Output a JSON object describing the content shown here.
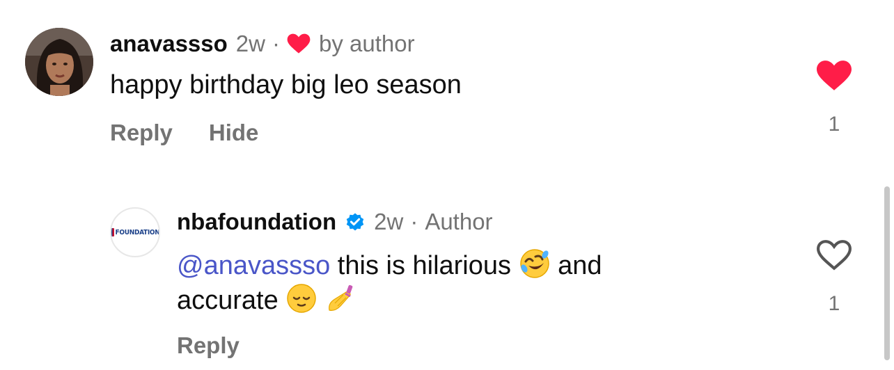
{
  "colors": {
    "like_red": "#ff1d48",
    "mention_blue": "#4a56c8",
    "verified_blue": "#0095f6",
    "muted_gray": "#737373"
  },
  "comments": [
    {
      "username": "anavassso",
      "time": "2w",
      "separator": "·",
      "author_badge": "by author",
      "author_badge_icon": "heart-filled-icon",
      "text": "happy birthday big leo season",
      "actions": [
        "Reply",
        "Hide"
      ],
      "liked": true,
      "like_icon": "heart-filled-icon",
      "like_count": "1"
    },
    {
      "username": "nbafoundation",
      "verified": true,
      "verified_icon": "verified-badge-icon",
      "time": "2w",
      "separator": "·",
      "author_label": "Author",
      "avatar_label": "FOUNDATION",
      "mention": "@anavassso",
      "text_part1": " this is hilarious ",
      "text_part2": " and accurate ",
      "emojis": [
        "rolling-on-floor-laughing-emoji",
        "relieved-face-emoji",
        "nail-polish-emoji"
      ],
      "actions": [
        "Reply"
      ],
      "liked": false,
      "like_icon": "heart-outline-icon",
      "like_count": "1"
    }
  ]
}
